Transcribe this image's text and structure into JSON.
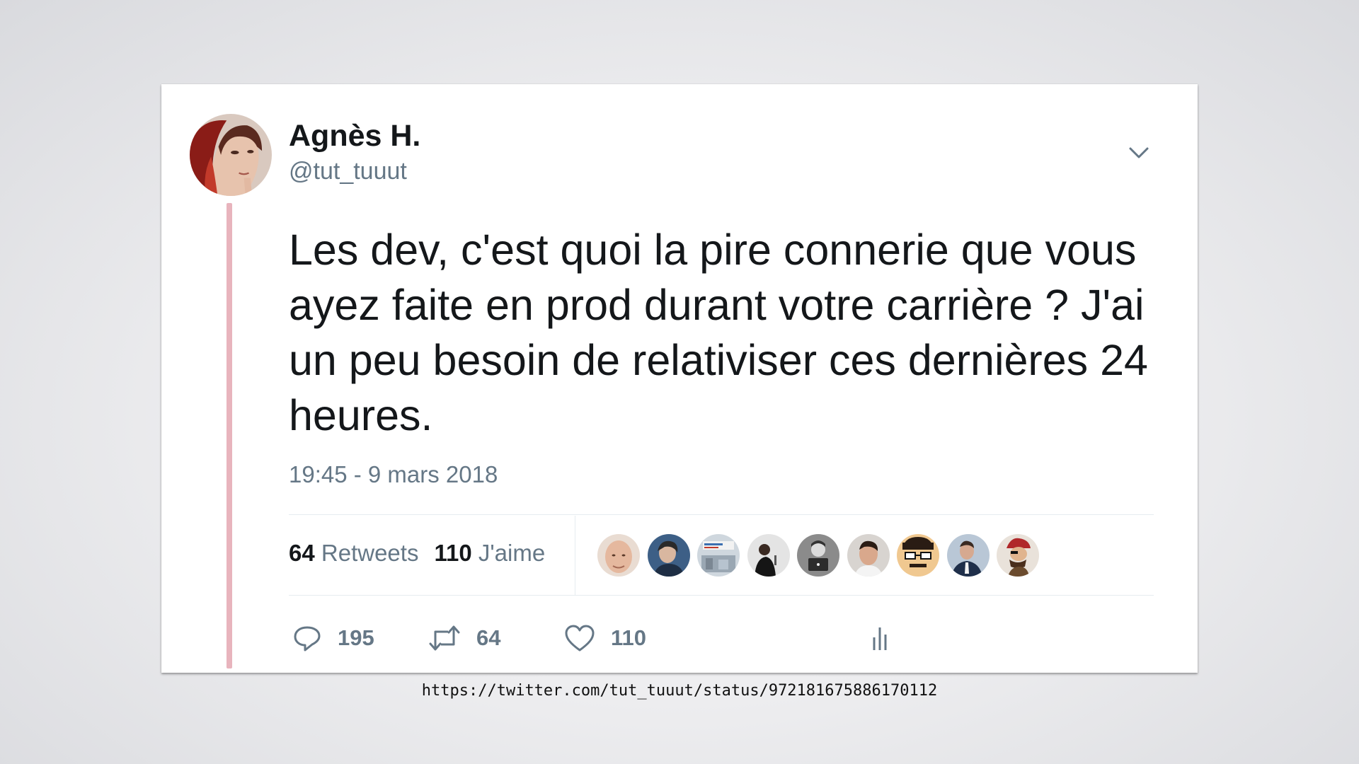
{
  "tweet": {
    "display_name": "Agnès H.",
    "handle": "@tut_tuuut",
    "text": "Les dev, c'est quoi la pire connerie que vous ayez faite en prod durant votre carrière ? J'ai un peu besoin de relativiser ces dernières 24 heures.",
    "timestamp": "19:45 - 9 mars 2018",
    "avatar_icon": "woman-portrait-avatar",
    "caret_icon": "chevron-down-icon",
    "thread_color": "#e8b4bd"
  },
  "stats": {
    "retweets_count": "64",
    "retweets_label": "Retweets",
    "likes_count": "110",
    "likes_label": "J'aime",
    "likers": [
      {
        "name": "liker-avatar-1",
        "bg": "#e9dcd2"
      },
      {
        "name": "liker-avatar-2",
        "bg": "#3d5f86"
      },
      {
        "name": "liker-avatar-3",
        "bg": "#cfd7de"
      },
      {
        "name": "liker-avatar-4",
        "bg": "#e4e4e4"
      },
      {
        "name": "liker-avatar-5",
        "bg": "#8b8b8b"
      },
      {
        "name": "liker-avatar-6",
        "bg": "#d8d4d0"
      },
      {
        "name": "liker-avatar-7",
        "bg": "#f0c890"
      },
      {
        "name": "liker-avatar-8",
        "bg": "#b9c7d6"
      },
      {
        "name": "liker-avatar-9",
        "bg": "#e9e2da"
      }
    ]
  },
  "actions": {
    "reply_count": "195",
    "retweet_count": "64",
    "like_count": "110",
    "reply_icon": "reply-icon",
    "retweet_icon": "retweet-icon",
    "like_icon": "heart-icon",
    "analytics_icon": "analytics-icon"
  },
  "caption": {
    "url": "https://twitter.com/tut_tuuut/status/972181675886170112"
  },
  "colors": {
    "text_primary": "#14171a",
    "text_secondary": "#657786",
    "divider": "#e6ecf0"
  }
}
